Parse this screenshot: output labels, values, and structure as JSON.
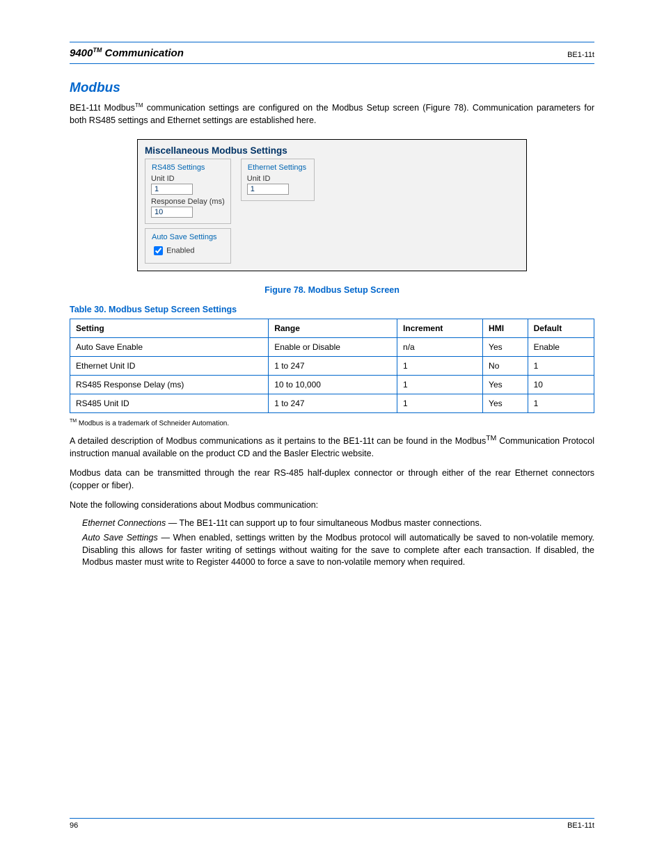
{
  "header": {
    "chapter": "9400",
    "chapter_sup": "TM",
    "title": "Communication",
    "doc_code": "BE1-11t"
  },
  "sections": {
    "h2": "Modbus",
    "para": "BE1-11t Modbus",
    "para_sup": "TM",
    "para_rest": " communication settings are configured on the Modbus Setup screen (Figure 78). Communication parameters for both RS485 settings and Ethernet settings are established here."
  },
  "figure": {
    "title": "Miscellaneous Modbus Settings",
    "rs485_legend": "RS485 Settings",
    "eth_legend": "Ethernet Settings",
    "unit_id_label": "Unit ID",
    "rs485_unit_id": "1",
    "eth_unit_id": "1",
    "resp_delay_label": "Response Delay (ms)",
    "resp_delay": "10",
    "autosave_legend": "Auto Save Settings",
    "autosave_label": "Enabled",
    "autosave_checked": true,
    "caption": "Figure 78. Modbus Setup Screen"
  },
  "table": {
    "caption": "Table 30. Modbus Setup Screen Settings",
    "cols": [
      "Setting",
      "Range",
      "Increment",
      "HMI",
      "Default"
    ],
    "rows": [
      [
        "Auto Save Enable",
        "Enable or Disable",
        "n/a",
        "Yes",
        "Enable"
      ],
      [
        "Ethernet Unit ID",
        "1 to 247",
        "1",
        "No",
        "1"
      ],
      [
        "RS485 Response Delay (ms)",
        "10 to 10,000",
        "1",
        "Yes",
        "10"
      ],
      [
        "RS485 Unit ID",
        "1 to 247",
        "1",
        "Yes",
        "1"
      ]
    ],
    "trademark_note_pre": "TM",
    "trademark_note": " Modbus is a trademark of Schneider Automation."
  },
  "notes": {
    "n1_pre": "A detailed description of Modbus communications as it pertains to the BE1-11t can be found in the Modbus",
    "n1_sup": "TM",
    "n1_post": " Communication Protocol instruction manual available on the product CD and the Basler Electric website.",
    "n2": "Modbus data can be transmitted through the rear RS-485 half-duplex connector or through either of the rear Ethernet connectors (copper or fiber).",
    "n3": "Note the following considerations about Modbus communication:",
    "sub": [
      {
        "k": "Ethernet Connections",
        "v": "— The BE1-11t can support up to four simultaneous Modbus master connections."
      },
      {
        "k": "Auto Save Settings",
        "v": "— When enabled, settings written by the Modbus protocol will automatically be saved to non-volatile memory. Disabling this allows for faster writing of settings without waiting for the save to complete after each transaction. If disabled, the Modbus master must write to Register 44000 to force a save to non-volatile memory when required."
      }
    ]
  },
  "footer": {
    "page": "96",
    "right": "BE1-11t"
  }
}
